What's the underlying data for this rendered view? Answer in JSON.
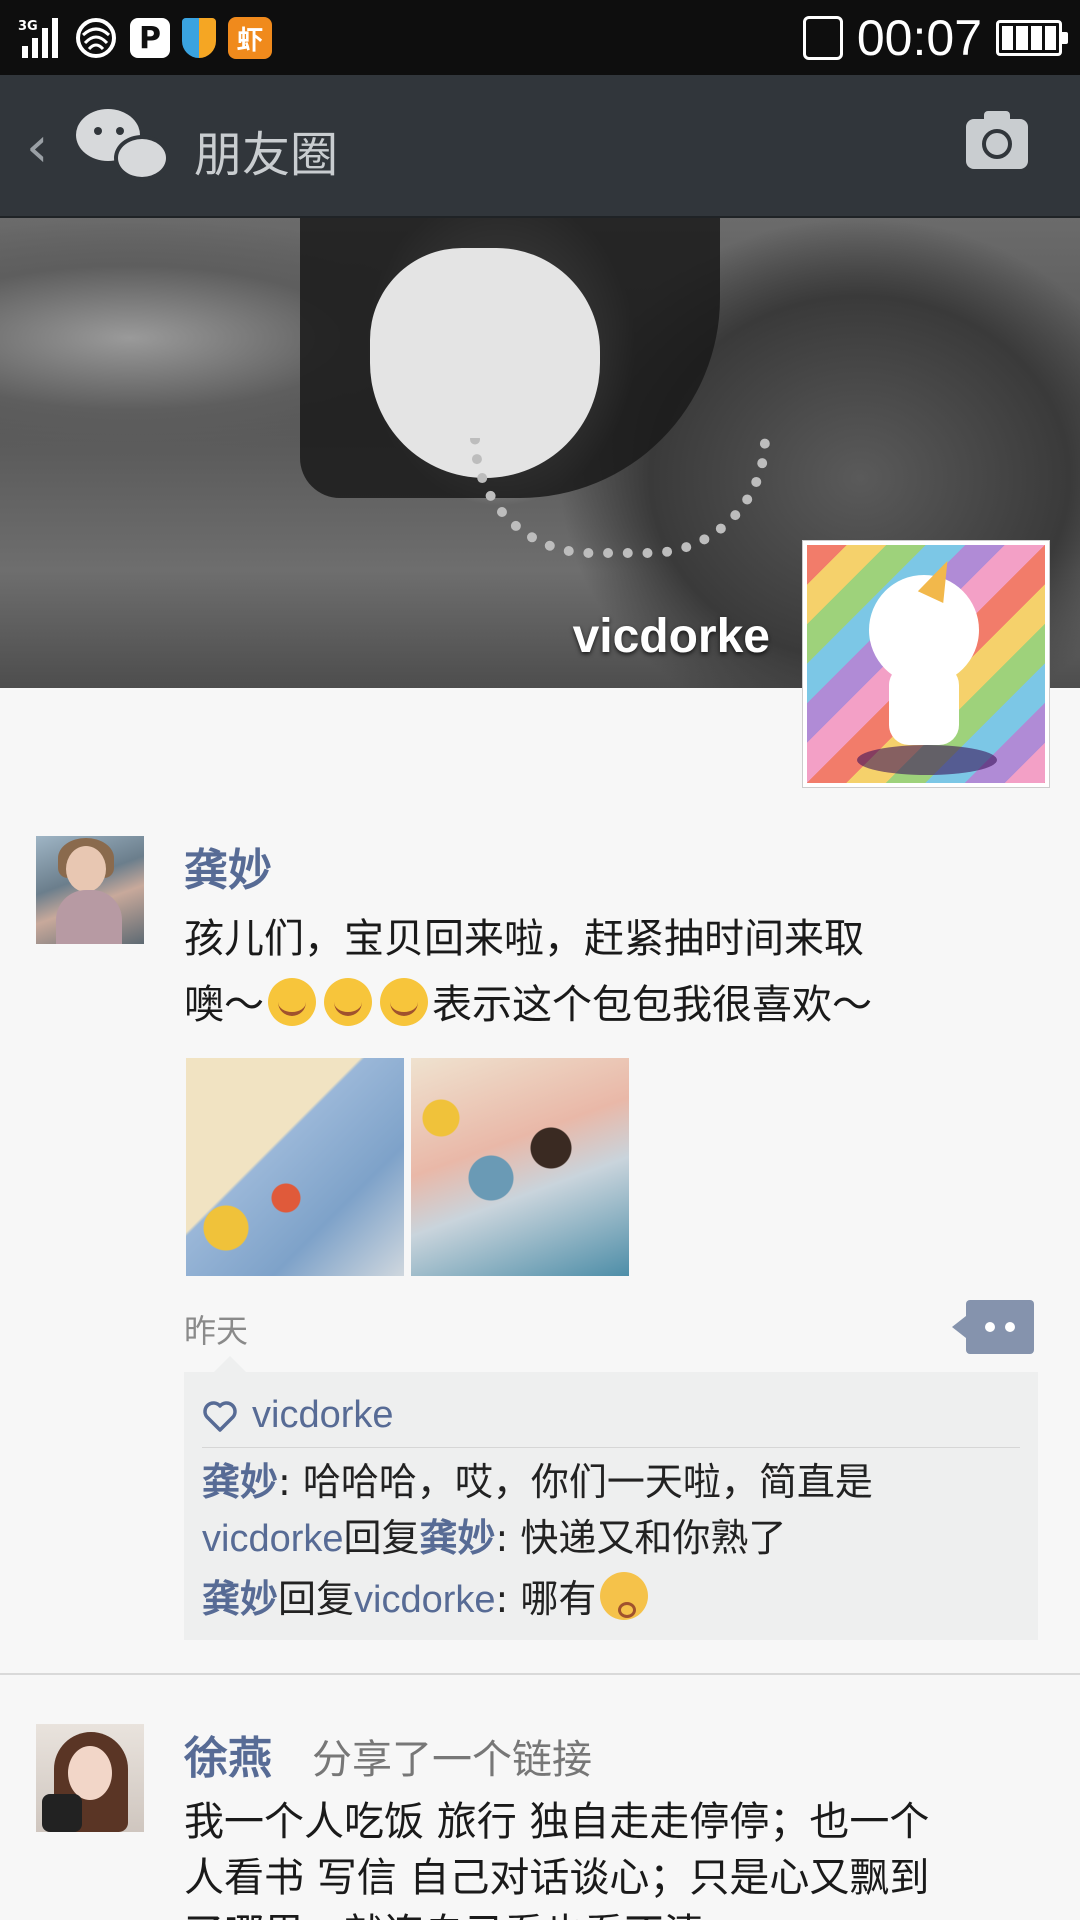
{
  "status_bar": {
    "network": "3G",
    "time": "00:07",
    "app_icons": [
      "signal-icon",
      "wifi-icon",
      "p-app-icon",
      "shield-icon",
      "xiami-icon"
    ],
    "xiami_label": "虾",
    "p_label": "P"
  },
  "header": {
    "title": "朋友圈"
  },
  "cover": {
    "username": "vicdorke"
  },
  "posts": [
    {
      "name": "龚妙",
      "text_line1": "孩儿们，宝贝回来啦，赶紧抽时间来取",
      "text_line2_a": "噢～",
      "text_line2_b": "表示这个包包我很喜欢～",
      "time": "昨天",
      "likes": "vicdorke",
      "comments": [
        {
          "name": "龚妙",
          "text": ": 哈哈哈，哎，你们一天啦，简直是"
        },
        {
          "name": "vicdorke",
          "reply_word": "回复",
          "to": "龚妙",
          "text": ": 快递又和你熟了"
        },
        {
          "name": "龚妙",
          "reply_word": "回复",
          "to": "vicdorke",
          "text": ": 哪有"
        }
      ]
    },
    {
      "name": "徐燕",
      "sub": "分享了一个链接",
      "text_line1": "我一个人吃饭 旅行 独自走走停停；也一个",
      "text_line2": "人看书 写信 自己对话谈心；只是心又飘到",
      "text_line3": "了哪里，就连自己看也看不清"
    }
  ],
  "colors": {
    "name_blue": "#576b95",
    "title_bar": "#31363b",
    "status_bar": "#0e0e0e",
    "comment_bg": "#eeefef"
  }
}
